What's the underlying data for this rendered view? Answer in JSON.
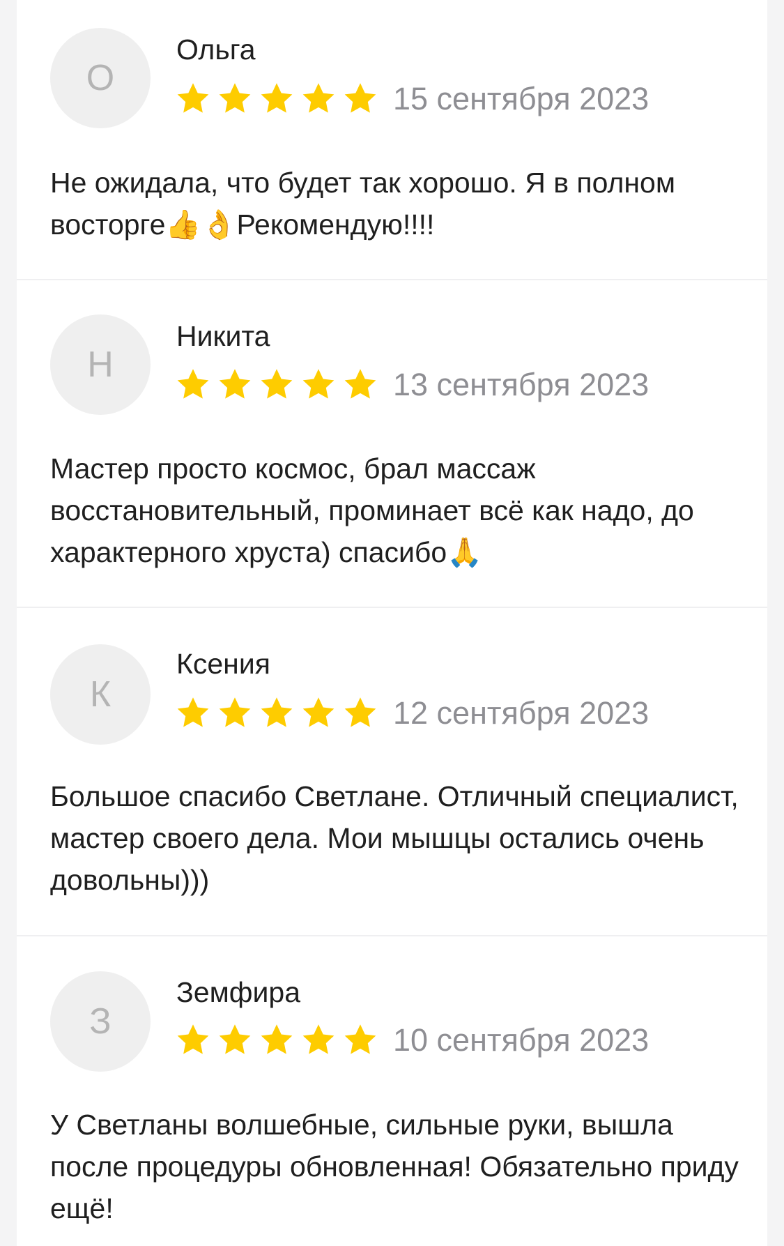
{
  "reviews": [
    {
      "initial": "О",
      "name": "Ольга",
      "rating": 5,
      "date": "15 сентября 2023",
      "text": "Не ожидала, что будет так хорошо. Я в полном восторге👍👌Рекомендую!!!!"
    },
    {
      "initial": "Н",
      "name": "Никита",
      "rating": 5,
      "date": "13 сентября 2023",
      "text": "Мастер просто космос, брал массаж восстановительный, проминает всё как надо, до характерного хруста) спасибо🙏"
    },
    {
      "initial": "К",
      "name": "Ксения",
      "rating": 5,
      "date": "12 сентября 2023",
      "text": "Большое спасибо Светлане. Отличный специалист, мастер своего дела. Мои мышцы остались очень довольны)))"
    },
    {
      "initial": "З",
      "name": "Земфира",
      "rating": 5,
      "date": "10 сентября 2023",
      "text": "У Светланы волшебные, сильные руки, вышла после процедуры обновленная! Обязательно приду ещё!"
    }
  ],
  "colors": {
    "star": "#fecc00",
    "avatar_bg": "#efefef",
    "avatar_letter": "#b4b4b4",
    "date": "#8e8e93",
    "text": "#1f1f1f"
  },
  "icons": {
    "star": "star-icon"
  }
}
